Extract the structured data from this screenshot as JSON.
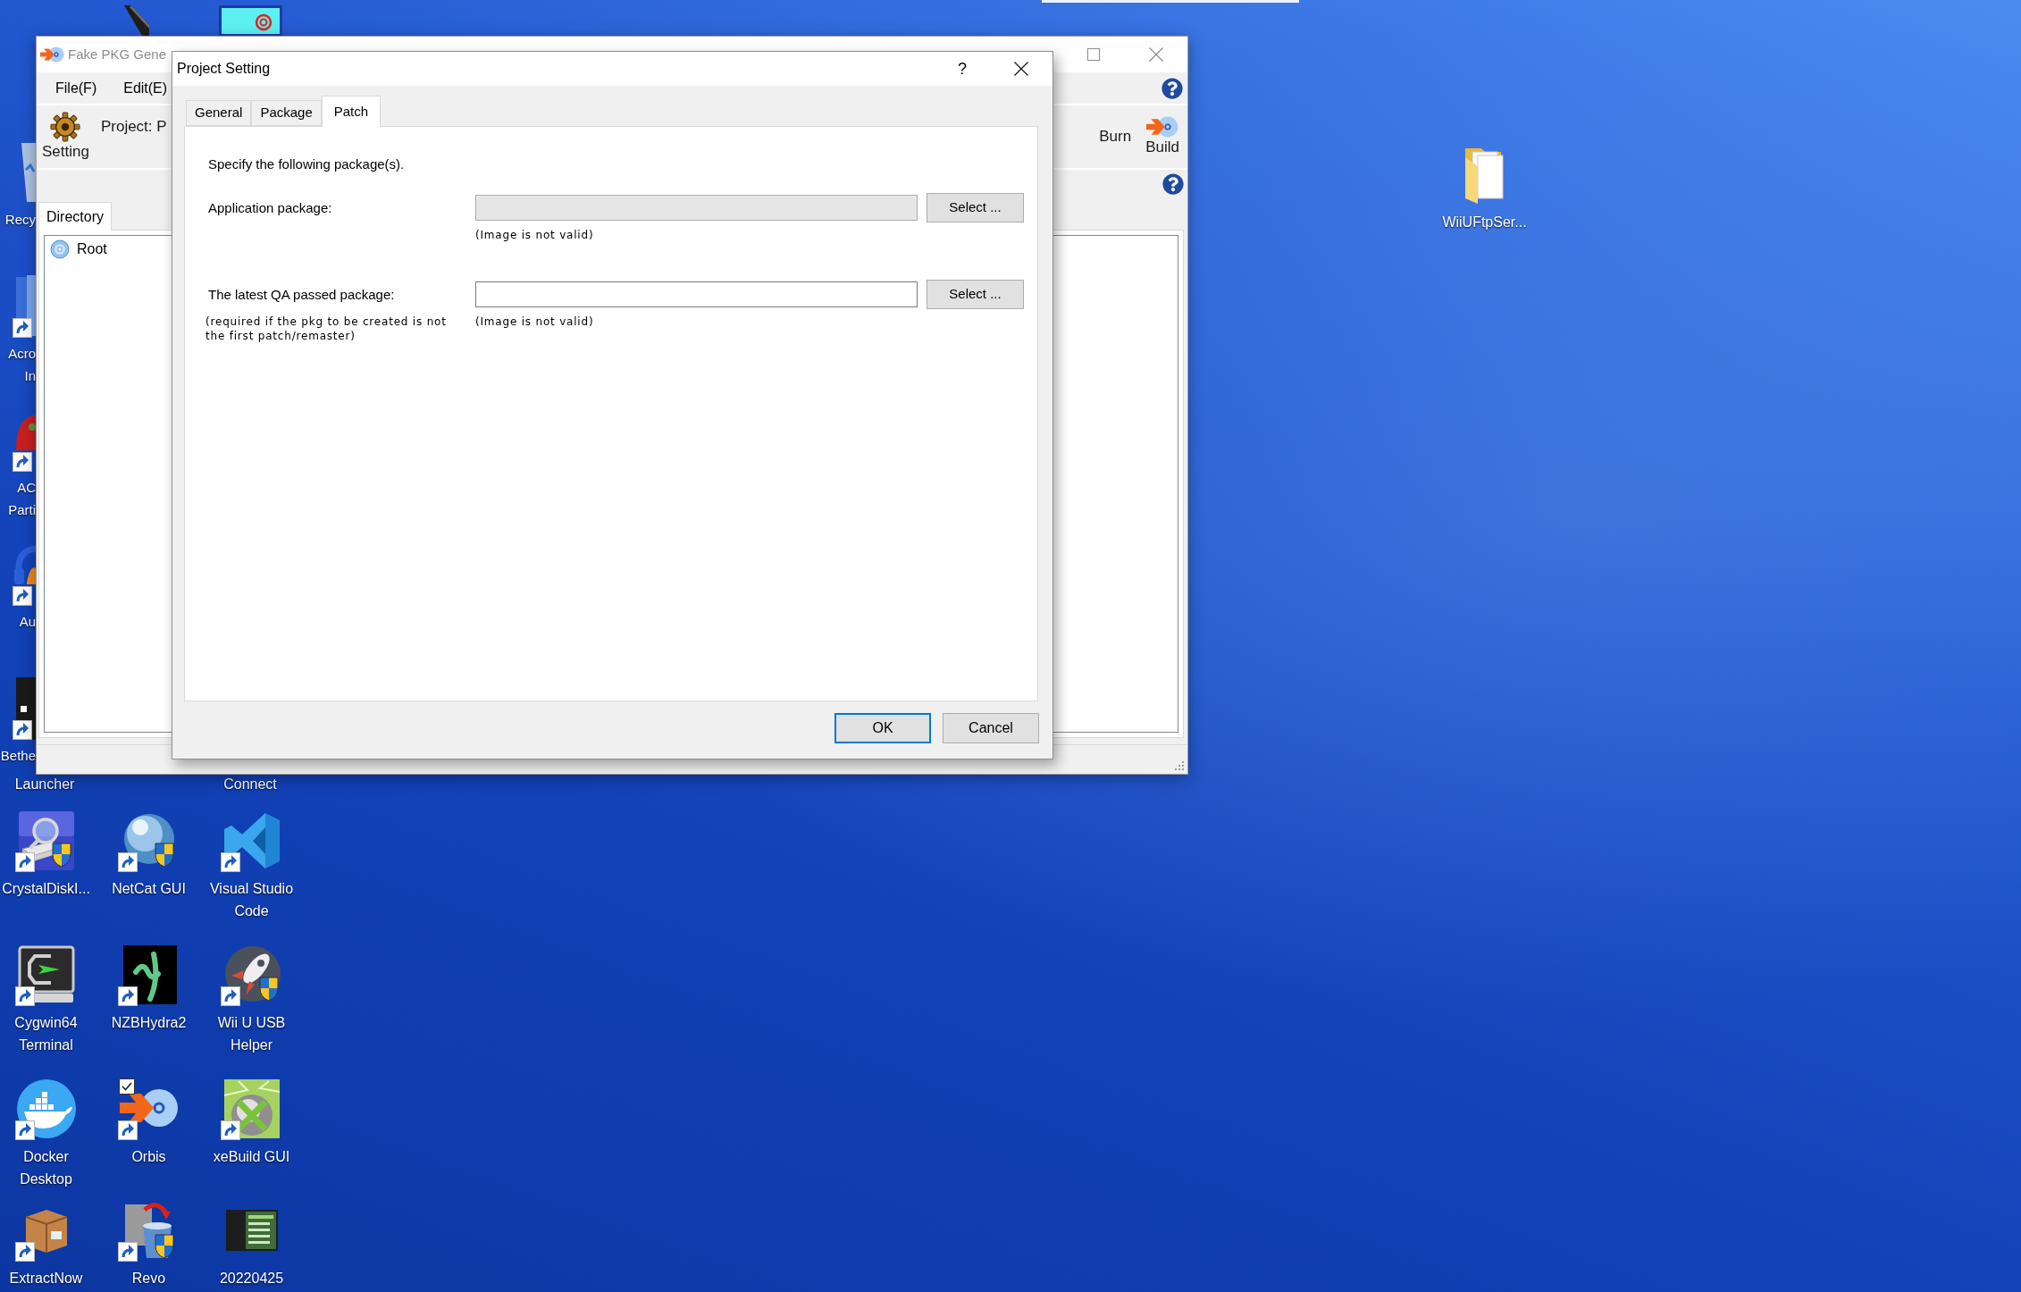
{
  "desktop": {
    "partial_icons": [
      {
        "label_lines": [
          "Recy"
        ],
        "shortcut": false
      },
      {
        "label_lines": [
          "Acro",
          "In"
        ],
        "shortcut": true
      },
      {
        "label_lines": [
          "AC",
          "Parti"
        ],
        "shortcut": true
      },
      {
        "label_lines": [
          "Au"
        ],
        "shortcut": true
      },
      {
        "label_lines": [
          "Bethe"
        ],
        "shortcut": true
      }
    ],
    "labels_below_window": [
      "Launcher",
      "Connect"
    ],
    "icons": [
      {
        "label": "CrystalDiskI...",
        "shortcut": true,
        "checked": false
      },
      {
        "label": "NetCat GUI",
        "shortcut": true,
        "checked": false
      },
      {
        "label": "Visual Studio Code",
        "shortcut": true,
        "checked": false
      },
      {
        "label": "Cygwin64 Terminal",
        "shortcut": true,
        "checked": false
      },
      {
        "label": "NZBHydra2",
        "shortcut": true,
        "checked": false
      },
      {
        "label": "Wii U USB Helper",
        "shortcut": true,
        "checked": false
      },
      {
        "label": "Docker Desktop",
        "shortcut": true,
        "checked": false
      },
      {
        "label": "Orbis",
        "shortcut": true,
        "checked": true
      },
      {
        "label": "xeBuild GUI",
        "shortcut": true,
        "checked": false
      },
      {
        "label": "ExtractNow",
        "shortcut": true,
        "checked": false
      },
      {
        "label": "Revo",
        "shortcut": true,
        "checked": false
      },
      {
        "label": "20220425",
        "shortcut": false,
        "checked": false
      }
    ],
    "right_icons": [
      {
        "label": "WiiUFtpSer...",
        "shortcut": false,
        "checked": false
      }
    ]
  },
  "main_window": {
    "title": "Fake PKG Gene",
    "menu": [
      "File(F)",
      "Edit(E)"
    ],
    "toolbar": {
      "setting": "Setting",
      "project": "Project: P",
      "burn": "Burn",
      "build": "Build"
    },
    "tabs": [
      {
        "label": "Directory",
        "selected": true
      }
    ],
    "tree": [
      {
        "label": "Root"
      }
    ]
  },
  "dialog": {
    "title": "Project Setting",
    "help_button": "?",
    "tabs": [
      {
        "label": "General",
        "selected": false
      },
      {
        "label": "Package",
        "selected": false
      },
      {
        "label": "Patch",
        "selected": true
      }
    ],
    "intro": "Specify the following package(s).",
    "fields": [
      {
        "label": "Application package:",
        "read_only": true,
        "button": "Select ...",
        "status": "(Image is not valid)"
      },
      {
        "label": "The latest QA passed package:",
        "note": "(required if the pkg to be created is not the first patch/remaster)",
        "read_only": false,
        "button": "Select ...",
        "status": "(Image is not valid)"
      }
    ],
    "buttons": [
      {
        "label": "OK",
        "default": true
      },
      {
        "label": "Cancel",
        "default": false
      }
    ]
  }
}
